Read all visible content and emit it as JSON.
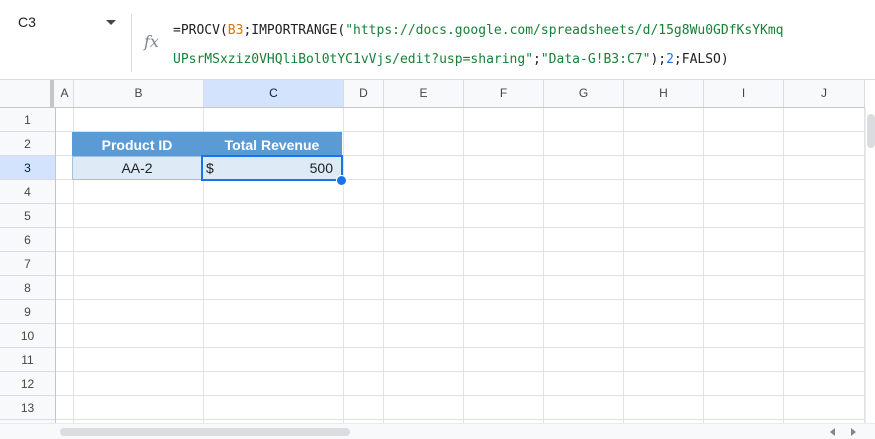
{
  "name_box": {
    "ref": "C3"
  },
  "formula_bar": {
    "fx_label": "fx",
    "line1": [
      {
        "t": "=PROCV(",
        "c": "plain"
      },
      {
        "t": "B3",
        "c": "ref-orange"
      },
      {
        "t": ";IMPORTRANGE(",
        "c": "plain"
      },
      {
        "t": "\"https://docs.google.com/spreadsheets/d/15g8Wu0GDfKsYKmq",
        "c": "str-green"
      }
    ],
    "line2": [
      {
        "t": "UPsrMSxziz0VHQliBol0tYC1vVjs/edit?usp=sharing\"",
        "c": "str-green"
      },
      {
        "t": ";",
        "c": "plain"
      },
      {
        "t": "\"Data-G!B3:C7\"",
        "c": "str-green"
      },
      {
        "t": ");",
        "c": "plain"
      },
      {
        "t": "2",
        "c": "num-blue"
      },
      {
        "t": ";FALSO)",
        "c": "plain"
      }
    ]
  },
  "columns": [
    "A",
    "B",
    "C",
    "D",
    "E",
    "F",
    "G",
    "H",
    "I",
    "J"
  ],
  "selected_column": "C",
  "rows": [
    "1",
    "2",
    "3",
    "4",
    "5",
    "6",
    "7",
    "8",
    "9",
    "10",
    "11",
    "12",
    "13"
  ],
  "selected_row": "3",
  "table": {
    "header_product": "Product ID",
    "header_revenue": "Total Revenue",
    "product_value": "AA-2",
    "currency_symbol": "$",
    "revenue_value": "500"
  },
  "colors": {
    "header_fill": "#5b9bd5",
    "data_fill": "#deeaf6",
    "selection": "#1a73e8"
  }
}
